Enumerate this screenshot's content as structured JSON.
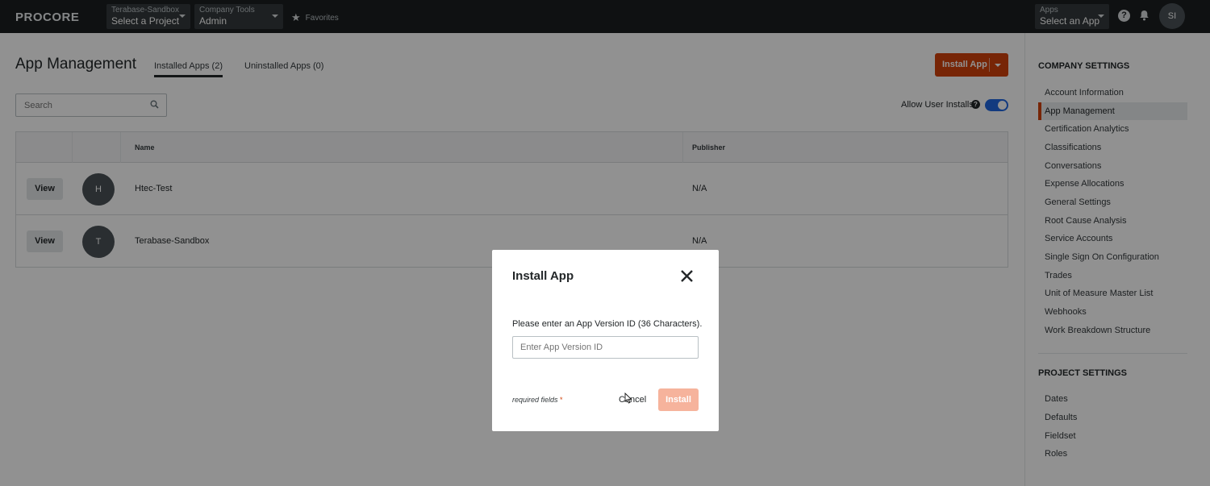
{
  "topnav": {
    "logo": "PROCORE",
    "project_picker": {
      "label": "Terabase-Sandbox",
      "value": "Select a Project"
    },
    "tool_picker": {
      "label": "Company Tools",
      "value": "Admin"
    },
    "favorites": "Favorites",
    "apps_picker": {
      "label": "Apps",
      "value": "Select an App"
    },
    "user_initials": "SI"
  },
  "main": {
    "title": "App Management",
    "tabs": [
      {
        "label": "Installed Apps (2)",
        "active": true
      },
      {
        "label": "Uninstalled Apps (0)",
        "active": false
      }
    ],
    "install_button": "Install App",
    "search_placeholder": "Search",
    "allow_user_installs": "Allow User Installs",
    "toggle_on": true,
    "table": {
      "columns": [
        "Name",
        "Publisher"
      ],
      "rows": [
        {
          "view": "View",
          "initial": "H",
          "name": "Htec-Test",
          "publisher": "N/A"
        },
        {
          "view": "View",
          "initial": "T",
          "name": "Terabase-Sandbox",
          "publisher": "N/A"
        }
      ]
    }
  },
  "sidebar": {
    "company_heading": "COMPANY SETTINGS",
    "company_items": [
      "Account Information",
      "App Management",
      "Certification Analytics",
      "Classifications",
      "Conversations",
      "Expense Allocations",
      "General Settings",
      "Root Cause Analysis",
      "Service Accounts",
      "Single Sign On Configuration",
      "Trades",
      "Unit of Measure Master List",
      "Webhooks",
      "Work Breakdown Structure"
    ],
    "active_item": "App Management",
    "project_heading": "PROJECT SETTINGS",
    "project_items": [
      "Dates",
      "Defaults",
      "Fieldset",
      "Roles"
    ]
  },
  "modal": {
    "title": "Install App",
    "message": "Please enter an App Version ID (36 Characters).",
    "input_placeholder": "Enter App Version ID",
    "required_label": "required fields",
    "required_star": "*",
    "cancel": "Cancel",
    "install": "Install"
  },
  "colors": {
    "brand_orange": "#d1410c",
    "nav_dark": "#1b1f21",
    "toggle_blue": "#2066df",
    "disabled_install": "#f6b39c"
  }
}
